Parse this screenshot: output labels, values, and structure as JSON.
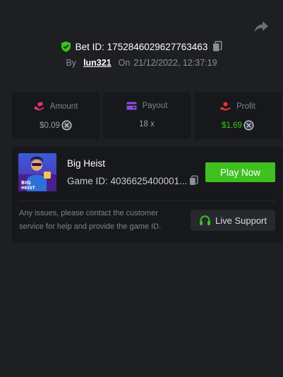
{
  "header": {
    "share_icon": "share-arrow-icon",
    "bet_id_label": "Bet ID: 1752846029627763463",
    "by_label": "By",
    "username": "lun321",
    "on_label": "On",
    "timestamp": "21/12/2022, 12:37:19"
  },
  "stats": {
    "amount": {
      "label": "Amount",
      "value": "$0.09",
      "icon": "hand-coins-icon"
    },
    "payout": {
      "label": "Payout",
      "value": "18 x",
      "icon": "wallet-card-icon"
    },
    "profit": {
      "label": "Profit",
      "value": "$1.69",
      "icon": "profit-hand-icon"
    }
  },
  "game": {
    "title": "Big Heist",
    "game_id_text": "Game ID: 4036625400001...",
    "thumbnail_text": "BIG HEIST",
    "play_label": "Play Now",
    "help_text": "Any issues, please contact the customer service for help and provide the game ID.",
    "support_label": "Live Support"
  },
  "colors": {
    "background": "#1e1f23",
    "card": "#17181c",
    "accent_green": "#3fc01f",
    "profit_green": "#35c51d",
    "amount_icon": "#e0336b",
    "payout_icon": "#8a4de8",
    "profit_icon": "#e8343b"
  }
}
